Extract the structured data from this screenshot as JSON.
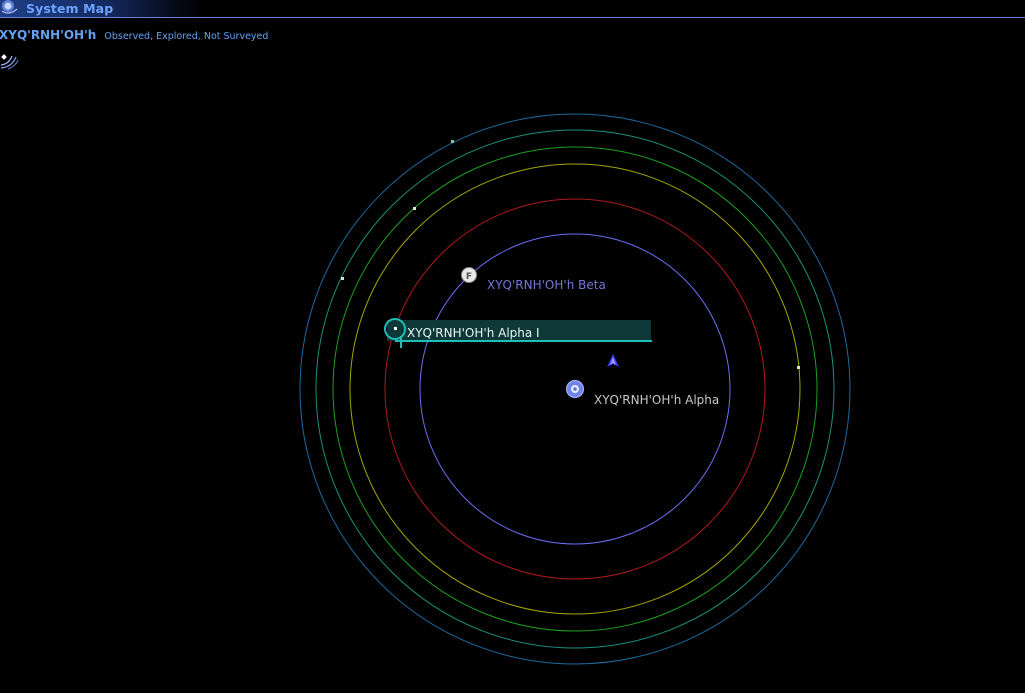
{
  "window": {
    "title": "System Map"
  },
  "system": {
    "name": "XYQ'RNH'OH'h",
    "status": "Observed, Explored, Not Surveyed"
  },
  "bodies": {
    "star_label": "XYQ'RNH'OH'h Alpha",
    "planet_beta_label": "XYQ'RNH'OH'h Beta",
    "planet_beta_badge": "F",
    "selected_label": "XYQ'RNH'OH'h Alpha I"
  },
  "colors": {
    "title_text": "#6fa3ff",
    "header_text": "#63a2f0",
    "orbit_inner": "#6a6ef0",
    "orbit_red": "#b01818",
    "orbit_yellow": "#a6a400",
    "orbit_green": "#1aa020",
    "orbit_teal": "#1b8f80",
    "orbit_blue": "#1d6a9e",
    "selection": "#1fbfb6",
    "label_beta": "#7476d8",
    "label_star": "#c8c8c8",
    "label_selected": "#e8f8f8"
  },
  "icons": {
    "title": "system-map-icon",
    "comms": "signal-icon",
    "fleet": "fleet-icon",
    "star": "star-icon",
    "badge": "planet-badge-icon"
  }
}
